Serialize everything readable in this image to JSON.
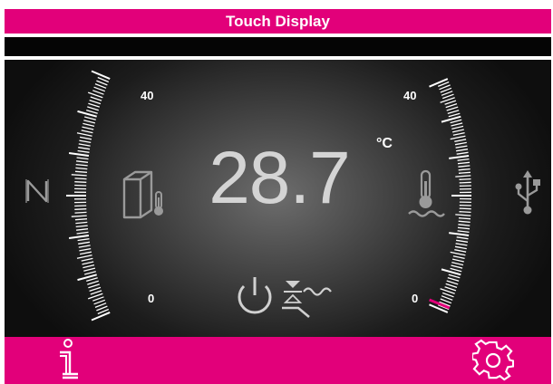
{
  "header": {
    "title": "Touch Display"
  },
  "display": {
    "temperature": "28.7",
    "unit": "°C",
    "left_scale": {
      "max": "40",
      "min": "0"
    },
    "right_scale": {
      "max": "40",
      "min": "0"
    },
    "right_scale_level": 0.02
  },
  "colors": {
    "accent": "#e2007a",
    "display_text": "#d4d4d4",
    "icon_gray": "#9a9a9a"
  },
  "icons": {
    "left": "nfc-icon",
    "box_temperature": "enclosure-temperature-icon",
    "water_temperature": "water-temperature-icon",
    "power_mode": "power-mode-icon",
    "usb": "usb-icon",
    "info": "info-icon",
    "settings": "settings-gear-icon"
  }
}
